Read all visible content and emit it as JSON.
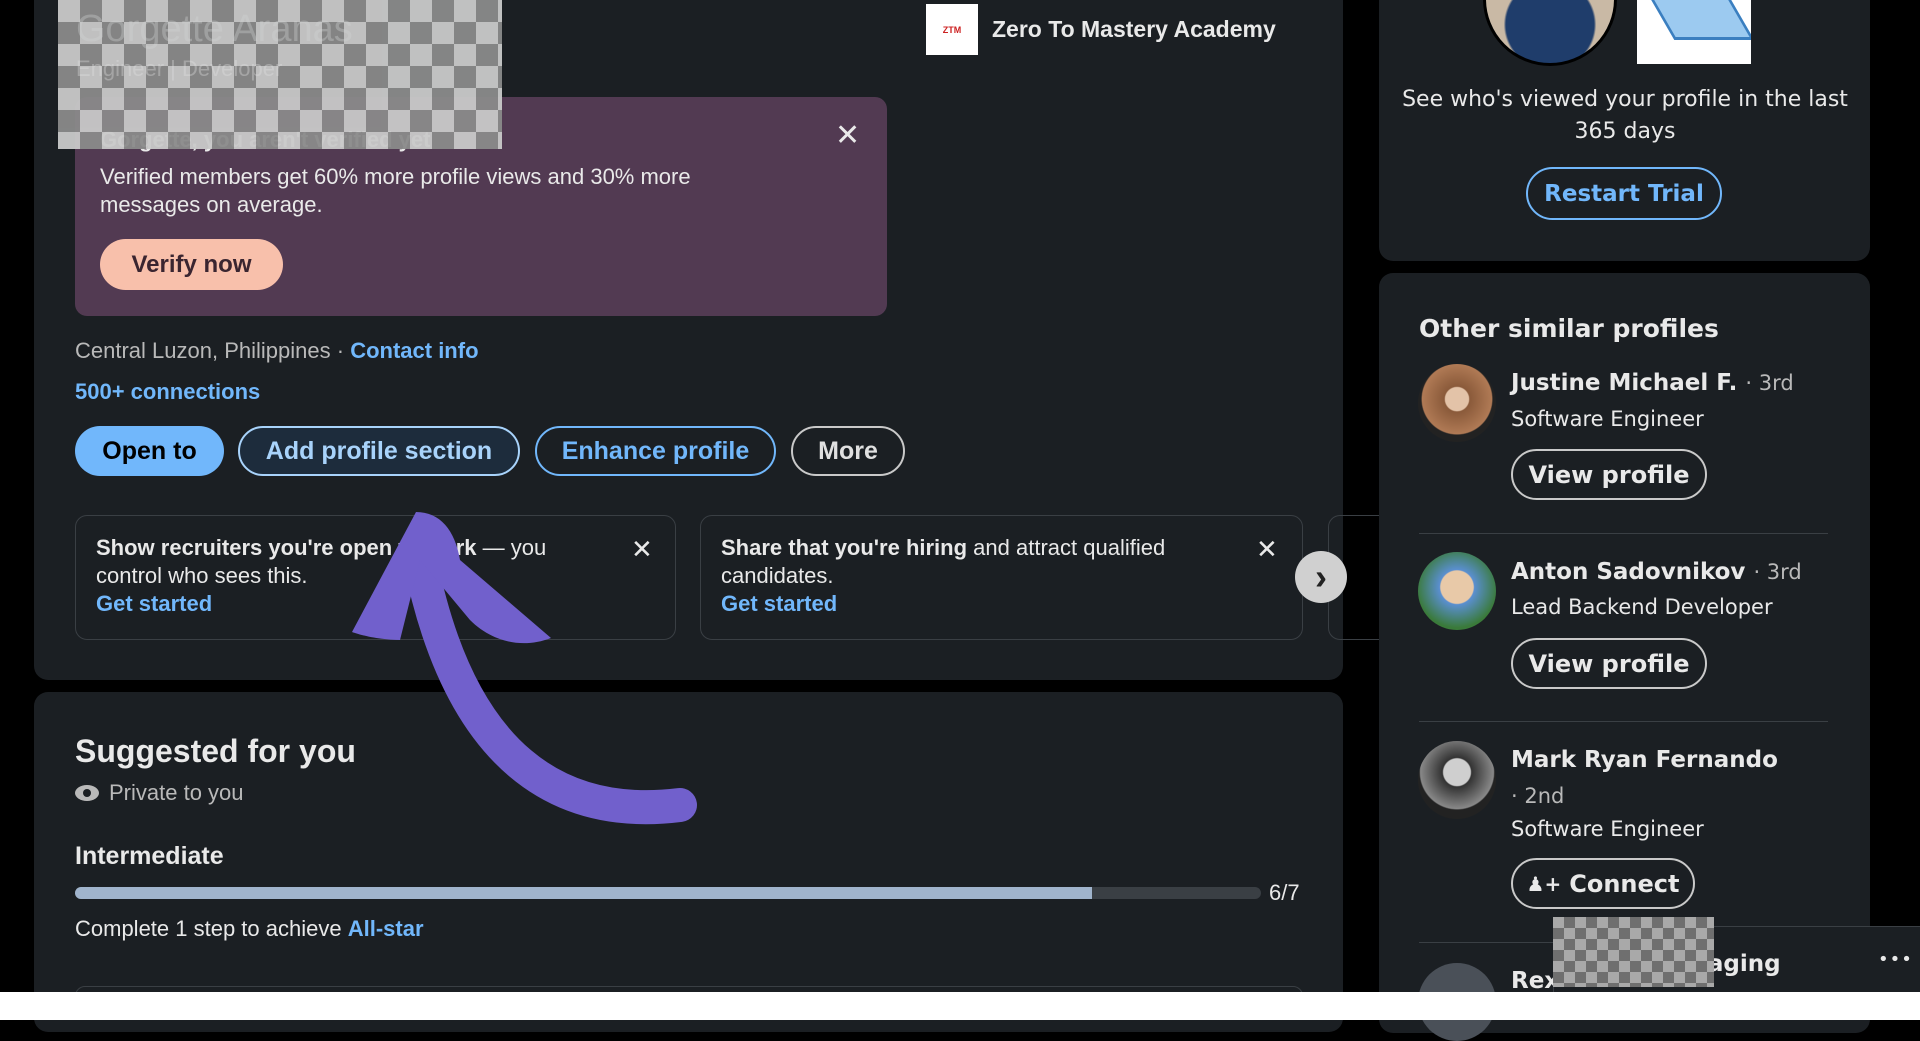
{
  "profile": {
    "name": "Gorgette Aranas",
    "headline": "Engineer | Developer",
    "company": "Zero To Mastery Academy",
    "company_logo_text": "ZTM",
    "location": "Central Luzon, Philippines",
    "separator": "·",
    "contact_info": "Contact info",
    "connections": "500+ connections"
  },
  "verify_banner": {
    "title": "Gorgette, you aren't verified yet",
    "body": "Verified members get 60% more profile views and 30% more messages on average.",
    "button": "Verify now",
    "close": "✕"
  },
  "actions": {
    "open_to": "Open to",
    "add_section": "Add profile section",
    "enhance": "Enhance profile",
    "more": "More"
  },
  "promos": [
    {
      "bold": "Show recruiters you're open to work",
      "text": " — you control who sees this.",
      "link": "Get started",
      "close": "✕"
    },
    {
      "bold": "Share that you're hiring",
      "text": " and attract qualified candidates.",
      "link": "Get started",
      "close": "✕"
    }
  ],
  "carousel_next": "›",
  "suggested": {
    "title": "Suggested for you",
    "privacy": "Private to you",
    "level": "Intermediate",
    "progress": {
      "value": 6,
      "max": 7,
      "label": "6/7"
    },
    "hint_prefix": "Complete 1 step to achieve ",
    "hint_link": "All-star"
  },
  "premium": {
    "text": "See who's viewed your profile in the last 365 days",
    "button": "Restart Trial"
  },
  "similar": {
    "title": "Other similar profiles",
    "items": [
      {
        "name": "Justine Michael F.",
        "degree": "· 3rd",
        "title": "Software Engineer",
        "action": "View profile"
      },
      {
        "name": "Anton Sadovnikov",
        "degree": "· 3rd",
        "title": "Lead Backend Developer",
        "action": "View profile"
      },
      {
        "name": "Mark Ryan Fernando",
        "degree": "· 2nd",
        "title": "Software Engineer",
        "action": "Connect"
      },
      {
        "name": "Rex"
      }
    ]
  },
  "messaging": {
    "label": "Messaging",
    "more": "•••"
  },
  "colors": {
    "accent": "#71b7fb",
    "banner": "#523a52",
    "verify": "#f8c0ab",
    "arrow": "#7160cc",
    "card": "#1b1f23"
  }
}
